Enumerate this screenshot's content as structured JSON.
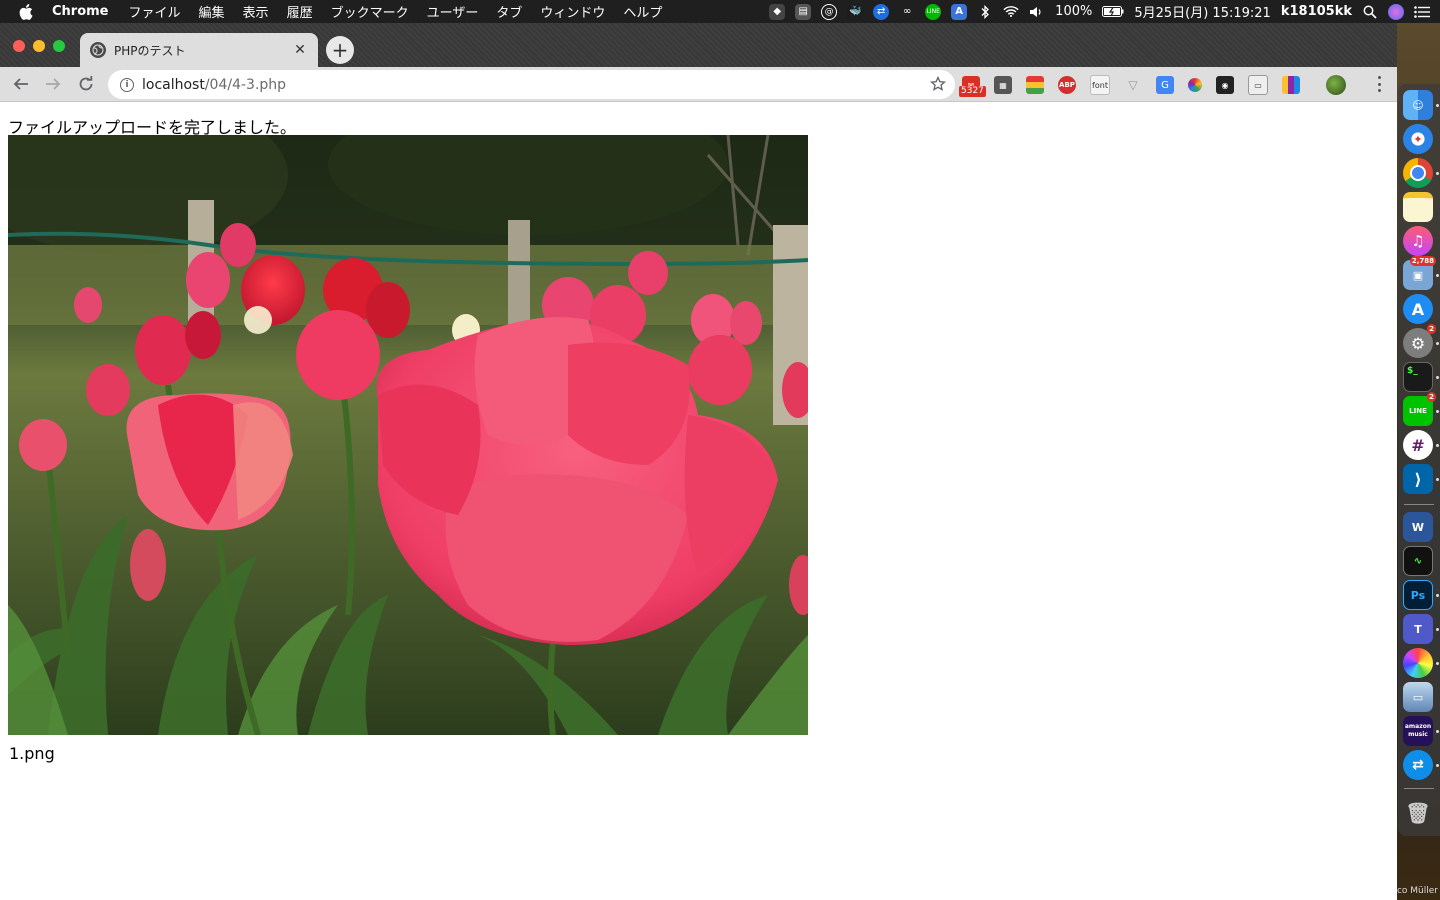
{
  "menubar": {
    "app_name": "Chrome",
    "items": [
      "ファイル",
      "編集",
      "表示",
      "履歴",
      "ブックマーク",
      "ユーザー",
      "タブ",
      "ウィンドウ",
      "ヘルプ"
    ],
    "battery": "100%",
    "datetime": "5月25日(月)  15:19:21",
    "user": "k18105kk"
  },
  "browser": {
    "tab_title": "PHPのテスト",
    "url_host": "localhost",
    "url_path": "/04/4-3.php",
    "gmail_badge": "5327"
  },
  "page": {
    "message": "ファイルアップロードを完了しました。",
    "file_name": "1.png",
    "image_alt": "1.png"
  },
  "dock": {
    "badges": {
      "preview": "2,788",
      "settings": "2",
      "line": "2"
    },
    "word_label": "W",
    "ps_label": "Ps",
    "teams_label": "T",
    "amazon_label": "amazon music"
  },
  "desktop": {
    "caption": "co Müller"
  },
  "colors": {
    "accent_red": "#fe5f57",
    "accent_yellow": "#febc2e",
    "accent_green": "#28c840",
    "tulip_pink": "#f0426a"
  }
}
